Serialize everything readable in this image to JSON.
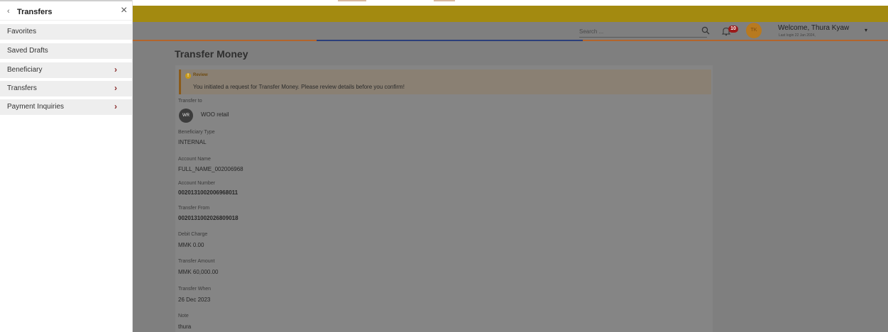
{
  "sidebar": {
    "back_icon": "‹",
    "title": "Transfers",
    "close_icon": "×",
    "items": [
      {
        "label": "Favorites",
        "chevron": ""
      },
      {
        "label": "Saved Drafts",
        "chevron": ""
      },
      {
        "label": "Beneficiary",
        "chevron": "›"
      },
      {
        "label": "Transfers",
        "chevron": "›"
      },
      {
        "label": "Payment Inquiries",
        "chevron": "›"
      }
    ]
  },
  "header": {
    "search_placeholder": "Search ...",
    "search_icon": "search-icon",
    "notification_count": "10",
    "avatar_initials": "TK",
    "welcome": "Welcome, Thura Kyaw",
    "last_login": "Last login 22 Jan 2024,",
    "caret": "▾"
  },
  "colors": {
    "brand_bar": "#a38a10",
    "accent_orange": "#b3652b",
    "accent_blue": "#2b3f7a",
    "badge_red": "#9b1b1b",
    "overlay_gray": "#7f7f7f"
  },
  "page": {
    "title": "Transfer Money",
    "review": {
      "title": "Review",
      "icon": "!",
      "message": "You initiated a request for Transfer Money. Please review details before you confirm!"
    },
    "transfer_to": {
      "label": "Transfer to",
      "avatar": "WR",
      "name": "WOO retail"
    },
    "fields": {
      "beneficiary_type": {
        "label": "Beneficiary Type",
        "value": "INTERNAL"
      },
      "account_name": {
        "label": "Account Name",
        "value": "FULL_NAME_002006968"
      },
      "account_number": {
        "label": "Account Number",
        "value": "0020131002006968011"
      },
      "transfer_from": {
        "label": "Transfer From",
        "value": "0020131002026809018"
      },
      "debit_charge": {
        "label": "Debit Charge",
        "value": "MMK 0.00"
      },
      "transfer_amount": {
        "label": "Transfer Amount",
        "value": "MMK 60,000.00"
      },
      "transfer_when": {
        "label": "Transfer When",
        "value": "26 Dec 2023"
      },
      "note": {
        "label": "Note",
        "value": "thura"
      }
    }
  }
}
